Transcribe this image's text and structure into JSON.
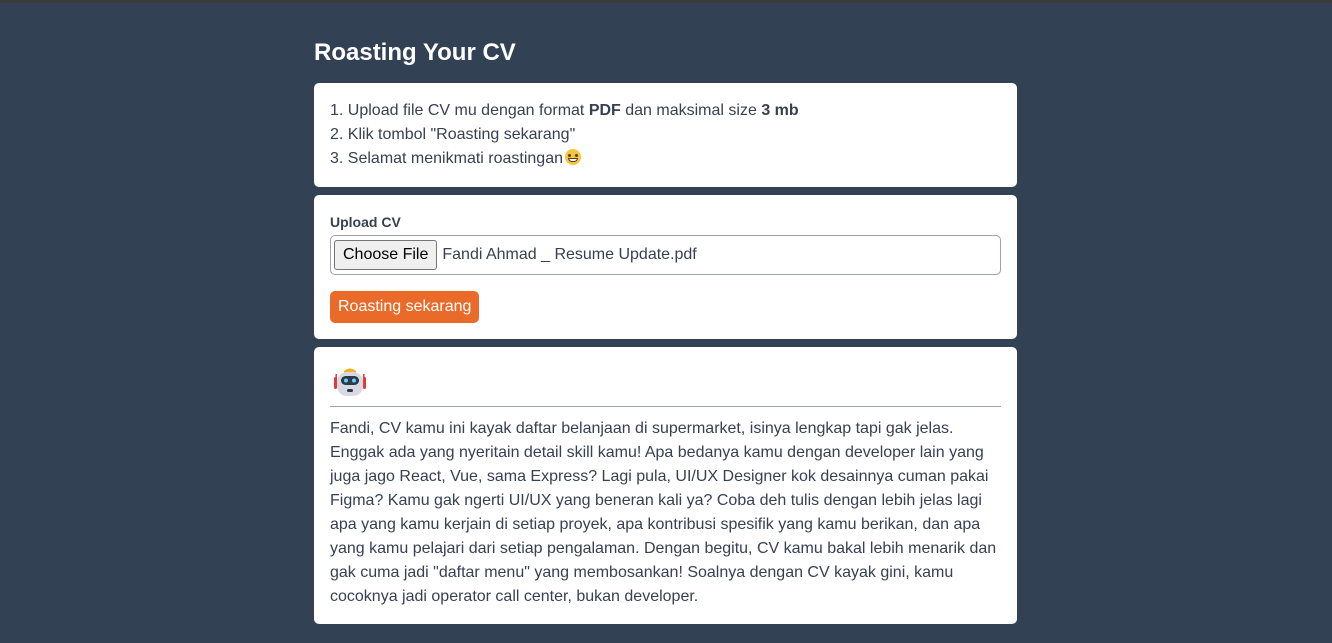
{
  "page": {
    "title": "Roasting Your CV"
  },
  "instructions": {
    "step1_prefix": "1. Upload file CV mu dengan format ",
    "step1_format": "PDF",
    "step1_middle": " dan maksimal size ",
    "step1_size": "3 mb",
    "step2": "2. Klik tombol \"Roasting sekarang\"",
    "step3": "3. Selamat menikmati roastingan",
    "step3_emoji_icon": "grinning-sweat-emoji-icon"
  },
  "upload": {
    "label": "Upload CV",
    "choose_file_label": "Choose File",
    "file_name": "Fandi Ahmad _ Resume Update.pdf",
    "submit_label": "Roasting sekarang"
  },
  "result": {
    "avatar_icon": "robot-icon",
    "text": "Fandi, CV kamu ini kayak daftar belanjaan di supermarket, isinya lengkap tapi gak jelas. Enggak ada yang nyeritain detail skill kamu! Apa bedanya kamu dengan developer lain yang juga jago React, Vue, sama Express? Lagi pula, UI/UX Designer kok desainnya cuman pakai Figma? Kamu gak ngerti UI/UX yang beneran kali ya? Coba deh tulis dengan lebih jelas lagi apa yang kamu kerjain di setiap proyek, apa kontribusi spesifik yang kamu berikan, dan apa yang kamu pelajari dari setiap pengalaman. Dengan begitu, CV kamu bakal lebih menarik dan gak cuma jadi \"daftar menu\" yang membosankan! Soalnya dengan CV kayak gini, kamu cocoknya jadi operator call center, bukan developer."
  },
  "colors": {
    "background": "#334155",
    "card": "#ffffff",
    "accent": "#ea6a2a",
    "text": "#374151"
  }
}
